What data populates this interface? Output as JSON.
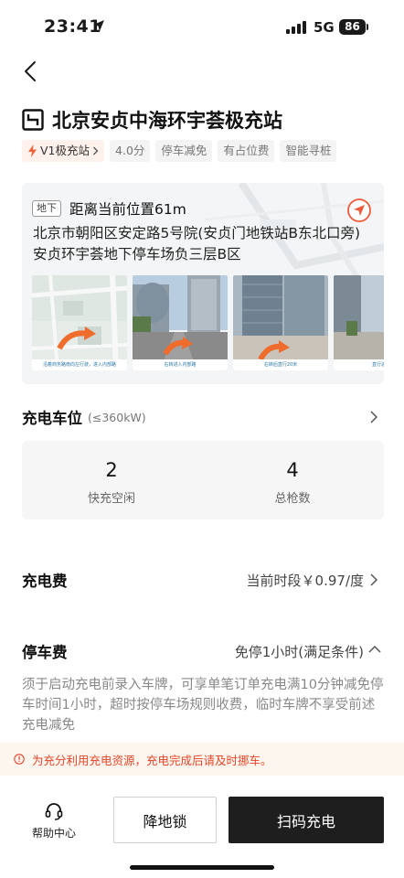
{
  "status_bar": {
    "time": "23:41",
    "network": "5G",
    "battery": "86"
  },
  "station": {
    "title": "北京安贞中海环宇荟极充站",
    "tags": [
      "V1极充站",
      "4.0分",
      "停车减免",
      "有占位费",
      "智能寻桩"
    ]
  },
  "location": {
    "level_tag": "地下",
    "distance": "距离当前位置61m",
    "address": "北京市朝阳区安定路5号院(安贞门地铁站B东北口旁)安贞环宇荟地下停车场负三层B区",
    "guide_images": [
      {
        "caption": "沿着商务路南向左行驶，进入内部路"
      },
      {
        "caption": "右转进入内部路"
      },
      {
        "caption": "右转后直行20米"
      },
      {
        "caption": "直行进入"
      }
    ]
  },
  "charging_spots": {
    "title": "充电车位",
    "subtitle": "(≤360kW)",
    "stats": [
      {
        "value": "2",
        "label": "快充空闲"
      },
      {
        "value": "4",
        "label": "总枪数"
      }
    ]
  },
  "charging_fee": {
    "title": "充电费",
    "value": "当前时段￥0.97/度"
  },
  "parking_fee": {
    "title": "停车费",
    "value": "免停1小时(满足条件)",
    "description": "须于启动充电前录入车牌，可享单笔订单充电满10分钟减免停车时间1小时，超时按停车场规则收费，临时车牌不享受前述充电减免"
  },
  "notice": {
    "text": "为充分利用充电资源，充电完成后请及时挪车。"
  },
  "bottom_bar": {
    "help_label": "帮助中心",
    "lock_label": "降地锁",
    "scan_label": "扫码充电"
  },
  "colors": {
    "accent_red": "#e4462a",
    "v1_tag_bg": "#fff1ec",
    "notice_bg": "#fdf6ee",
    "primary_button": "#1e1e1e"
  }
}
